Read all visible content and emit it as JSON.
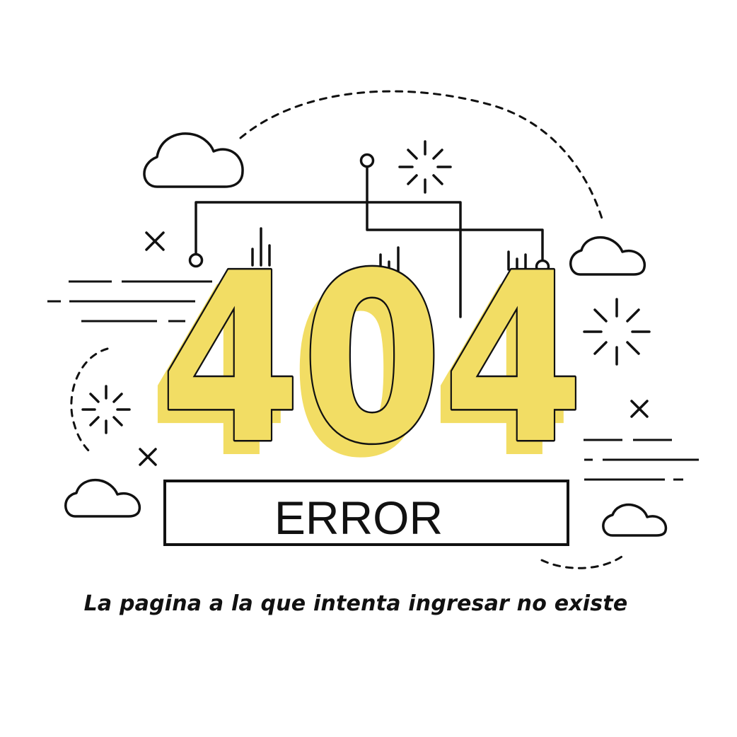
{
  "illustration": {
    "code": "404",
    "label": "ERROR",
    "accent_color": "#f2dd64",
    "line_color": "#111111",
    "icons": [
      "cloud-icon",
      "sparkle-icon",
      "cross-icon",
      "signal-bars-icon",
      "circuit-node-icon"
    ]
  },
  "message": "La pagina a la que intenta ingresar no existe"
}
